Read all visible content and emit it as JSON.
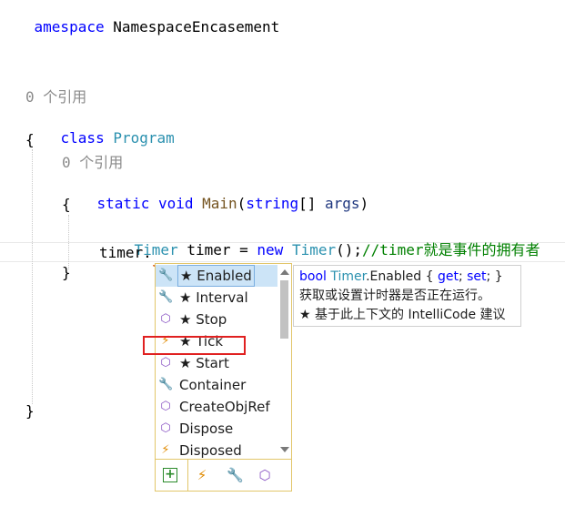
{
  "code": {
    "line1": {
      "kw": "amespace",
      "name": " NamespaceEncasement"
    },
    "lens1": "0 个引用",
    "line_class": {
      "kw": "class",
      "name": "Program"
    },
    "open_brace_outer": "{",
    "lens2": "0 个引用",
    "line_main": {
      "kw1": "static",
      "kw2": "void",
      "method": "Main",
      "p1": "(",
      "kw3": "string",
      "p2": "[] ",
      "param": "args",
      "p3": ")"
    },
    "open_brace_inner": "{",
    "line_timer": {
      "type1": "Timer",
      "var": " timer = ",
      "kw": "new",
      "type2": "Timer",
      "punct": "();",
      "comment": "//timer就是事件的拥有者"
    },
    "line_access": "timer.",
    "close_brace_inner": "}",
    "close_brace_outer": "}"
  },
  "completion": {
    "items": [
      {
        "label": "★ Enabled",
        "icon": "wrench-icon",
        "selected": true
      },
      {
        "label": "★ Interval",
        "icon": "wrench-icon"
      },
      {
        "label": "★ Stop",
        "icon": "cube-icon"
      },
      {
        "label": "★ Tick",
        "icon": "bolt-icon"
      },
      {
        "label": "★ Start",
        "icon": "cube-icon"
      },
      {
        "label": "Container",
        "icon": "wrench-icon"
      },
      {
        "label": "CreateObjRef",
        "icon": "cube-icon"
      },
      {
        "label": "Dispose",
        "icon": "cube-icon"
      },
      {
        "label": "Disposed",
        "icon": "bolt-icon"
      }
    ],
    "filters": [
      "add-filter-icon",
      "bolt-icon",
      "wrench-icon",
      "cube-icon"
    ]
  },
  "tooltip": {
    "signature_kw": "bool",
    "signature_type": "Timer",
    "signature_member": ".Enabled { ",
    "signature_get": "get",
    "signature_sep": "; ",
    "signature_set": "set",
    "signature_end": "; }",
    "description": "获取或设置计时器是否正在运行。",
    "intellicode": "★  基于此上下文的 IntelliCode 建议"
  },
  "colors": {
    "keyword": "#0000ff",
    "type": "#2b91af",
    "comment": "#008000",
    "highlight": "#e02020",
    "popup_border": "#e2c66a"
  }
}
